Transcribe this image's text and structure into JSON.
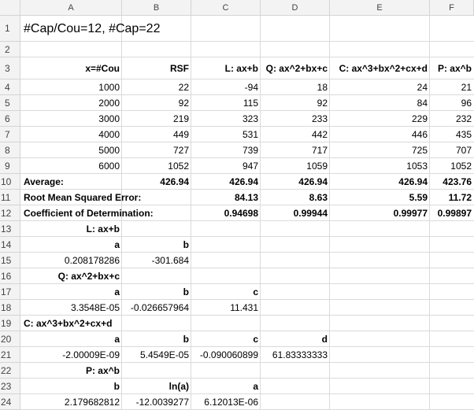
{
  "columns": [
    "A",
    "B",
    "C",
    "D",
    "E",
    "F"
  ],
  "rows": [
    "1",
    "2",
    "3",
    "4",
    "5",
    "6",
    "7",
    "8",
    "9",
    "10",
    "11",
    "12",
    "13",
    "14",
    "15",
    "16",
    "17",
    "18",
    "19",
    "20",
    "21",
    "22",
    "23",
    "24"
  ],
  "sheet": {
    "title": "#Cap/Cou=12, #Cap=22",
    "header": {
      "x": "x=#Cou",
      "rsf": "RSF",
      "lin": "L: ax+b",
      "quad": "Q: ax^2+bx+c",
      "cubic": "C: ax^3+bx^2+cx+d",
      "power": "P: ax^b"
    },
    "data_rows": [
      [
        "1000",
        "22",
        "-94",
        "18",
        "24",
        "21"
      ],
      [
        "2000",
        "92",
        "115",
        "92",
        "84",
        "96"
      ],
      [
        "3000",
        "219",
        "323",
        "233",
        "229",
        "232"
      ],
      [
        "4000",
        "449",
        "531",
        "442",
        "446",
        "435"
      ],
      [
        "5000",
        "727",
        "739",
        "717",
        "725",
        "707"
      ],
      [
        "6000",
        "1052",
        "947",
        "1059",
        "1053",
        "1052"
      ]
    ],
    "average": {
      "label": "Average:",
      "values": [
        "426.94",
        "426.94",
        "426.94",
        "426.94",
        "423.76"
      ]
    },
    "rmse": {
      "label": "Root Mean Squared Error:",
      "values": [
        "84.13",
        "8.63",
        "5.59",
        "11.72"
      ]
    },
    "r2": {
      "label": "Coefficient of Determination:",
      "values": [
        "0.94698",
        "0.99944",
        "0.99977",
        "0.99897"
      ]
    },
    "lin_block": {
      "title": "L: ax+b",
      "a_label": "a",
      "b_label": "b",
      "a": "0.208178286",
      "b": "-301.684"
    },
    "quad_block": {
      "title": "Q: ax^2+bx+c",
      "a_label": "a",
      "b_label": "b",
      "c_label": "c",
      "a": "3.3548E-05",
      "b": "-0.026657964",
      "c": "11.431"
    },
    "cubic_block": {
      "title": "C: ax^3+bx^2+cx+d",
      "a_label": "a",
      "b_label": "b",
      "c_label": "c",
      "d_label": "d",
      "a": "-2.00009E-09",
      "b": "5.4549E-05",
      "c": "-0.090060899",
      "d": "61.83333333"
    },
    "power_block": {
      "title": "P: ax^b",
      "b_label": "b",
      "lna_label": "ln(a)",
      "a_label": "a",
      "b": "2.179682812",
      "lna": "-12.0039277",
      "a": "6.12013E-06"
    }
  }
}
